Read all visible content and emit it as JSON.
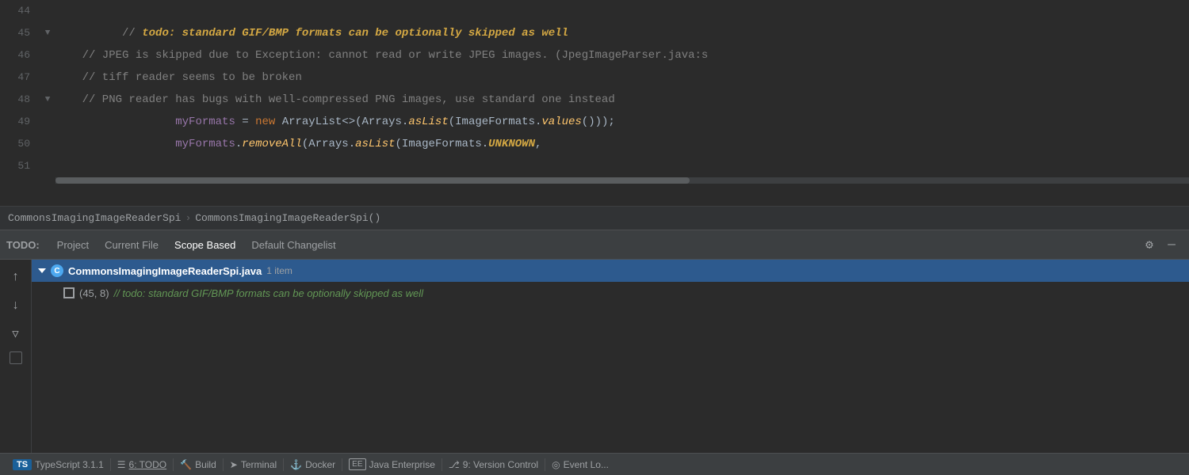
{
  "editor": {
    "lines": [
      {
        "number": "44",
        "gutter": "",
        "content": "",
        "parts": []
      },
      {
        "number": "45",
        "gutter": "▼",
        "content": "    // todo: standard GIF/BMP formats can be optionally skipped as well",
        "isTodo": true
      },
      {
        "number": "46",
        "gutter": "",
        "content": "    // JPEG is skipped due to Exception: cannot read or write JPEG images. (JpegImageParser.java:s",
        "isComment": true
      },
      {
        "number": "47",
        "gutter": "",
        "content": "    // tiff reader seems to be broken",
        "isComment": true
      },
      {
        "number": "48",
        "gutter": "▼",
        "content": "    // PNG reader has bugs with well-compressed PNG images, use standard one instead",
        "isComment": true
      },
      {
        "number": "49",
        "gutter": "",
        "content_plain": "        myFormats = new ArrayList<>(Arrays.asList(ImageFormats.values()));",
        "type": "code"
      },
      {
        "number": "50",
        "gutter": "",
        "content_plain": "        myFormats.removeAll(Arrays.asList(ImageFormats.UNKNOWN,",
        "type": "code"
      },
      {
        "number": "51",
        "gutter": "",
        "content": "",
        "type": "empty"
      }
    ],
    "breadcrumb": {
      "part1": "CommonsImagingImageReaderSpi",
      "sep": "›",
      "part2": "CommonsImagingImageReaderSpi()"
    }
  },
  "todo": {
    "label": "TODO:",
    "tabs": [
      {
        "id": "project",
        "label": "Project",
        "active": false
      },
      {
        "id": "current-file",
        "label": "Current File",
        "active": false
      },
      {
        "id": "scope-based",
        "label": "Scope Based",
        "active": true
      },
      {
        "id": "default-changelist",
        "label": "Default Changelist",
        "active": false
      }
    ],
    "tree": {
      "file": {
        "name": "CommonsImagingImageReaderSpi.java",
        "count": "1 item",
        "items": [
          {
            "location": "(45, 8)",
            "comment": "// todo: standard GIF/BMP formats can be optionally skipped as well"
          }
        ]
      }
    }
  },
  "sidebar_buttons": [
    {
      "id": "up",
      "icon": "↑"
    },
    {
      "id": "down",
      "icon": "↓"
    },
    {
      "id": "filter",
      "icon": "▼"
    },
    {
      "id": "square",
      "icon": "■"
    }
  ],
  "statusbar": {
    "typescript": "TypeScript 3.1.1",
    "todo": "6: TODO",
    "build": "Build",
    "terminal": "Terminal",
    "docker": "Docker",
    "java_enterprise": "Java Enterprise",
    "version_control": "9: Version Control",
    "event_log": "Event Lo..."
  }
}
